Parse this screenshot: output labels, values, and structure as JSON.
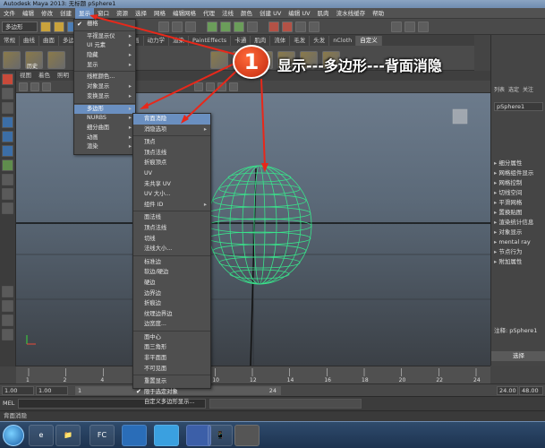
{
  "window": {
    "title": "Autodesk Maya 2013: 无标题   pSphere1"
  },
  "menubar": {
    "items": [
      "文件",
      "编辑",
      "修改",
      "创建",
      "显示",
      "窗口",
      "资源",
      "选择",
      "网格",
      "编辑网格",
      "代理",
      "法线",
      "颜色",
      "创建 UV",
      "编辑 UV",
      "肌肉",
      "流水线缓存",
      "帮助"
    ]
  },
  "toolbar": {
    "mode": "多边形"
  },
  "shelf": {
    "tabs": [
      "常规",
      "曲线",
      "曲面",
      "多边形",
      "细分",
      "变形",
      "动画",
      "动力学",
      "渲染",
      "PaintEffects",
      "卡通",
      "肌肉",
      "流体",
      "毛发",
      "头发",
      "nCloth",
      "自定义"
    ],
    "active_tab": "自定义",
    "icon_labels": [
      "历史"
    ]
  },
  "viewport": {
    "menu": [
      "视图",
      "着色",
      "照明",
      "显示",
      "面板"
    ],
    "label": "persp"
  },
  "display_menu": {
    "items": [
      {
        "label": "栅格",
        "check": true,
        "sub": false
      },
      {
        "label": "平视显示仪",
        "check": false,
        "sub": true
      },
      {
        "label": "UI 元素",
        "check": false,
        "sub": true
      },
      {
        "label": "隐藏",
        "check": false,
        "sub": true
      },
      {
        "label": "显示",
        "check": false,
        "sub": true
      },
      {
        "label": "线框颜色...",
        "check": false,
        "sub": false
      },
      {
        "label": "对象显示",
        "check": false,
        "sub": true
      },
      {
        "label": "变换显示",
        "check": false,
        "sub": true
      },
      {
        "label": "多边形",
        "check": false,
        "sub": true,
        "highlight": true
      },
      {
        "label": "NURBS",
        "check": false,
        "sub": true
      },
      {
        "label": "细分曲面",
        "check": false,
        "sub": true
      },
      {
        "label": "动画",
        "check": false,
        "sub": true
      },
      {
        "label": "渲染",
        "check": false,
        "sub": true
      }
    ]
  },
  "polygon_submenu": {
    "items": [
      {
        "label": "背面消隐",
        "highlight": true
      },
      {
        "label": "消隐选项",
        "sub": true
      },
      {
        "label": "顶点"
      },
      {
        "label": "顶点法线"
      },
      {
        "label": "折痕顶点"
      },
      {
        "label": "UV"
      },
      {
        "label": "未共享 UV"
      },
      {
        "label": "UV 大小..."
      },
      {
        "label": "组件 ID",
        "sub": true
      },
      {
        "label": "面法线"
      },
      {
        "label": "顶点法线"
      },
      {
        "label": "切线"
      },
      {
        "label": "法线大小..."
      },
      {
        "label": "标准边"
      },
      {
        "label": "软边/硬边"
      },
      {
        "label": "硬边"
      },
      {
        "label": "边界边"
      },
      {
        "label": "折痕边"
      },
      {
        "label": "纹理边界边"
      },
      {
        "label": "边宽度..."
      },
      {
        "label": "面中心"
      },
      {
        "label": "面三角形"
      },
      {
        "label": "非平面面"
      },
      {
        "label": "不可见面"
      },
      {
        "label": "重置显示"
      },
      {
        "label": "限于选定对象",
        "check": true
      },
      {
        "label": "自定义多边形显示..."
      }
    ]
  },
  "callout": {
    "number": "1",
    "text": "显示---多边形---背面消隐"
  },
  "right_panel": {
    "tabs": [
      "列表",
      "选定",
      "关注"
    ],
    "object_name": "pSphere1",
    "items": [
      "细分属性",
      "网格组件显示",
      "网格控制",
      "切线空间",
      "平滑网格",
      "置换贴图",
      "渲染统计信息",
      "对象显示",
      "mental ray",
      "节点行为",
      "附加属性"
    ],
    "note": "注释: pSphere1",
    "select_button": "选择"
  },
  "timeline": {
    "ticks": [
      "1",
      "2",
      "4",
      "6",
      "8",
      "10",
      "12",
      "14",
      "16",
      "18",
      "20",
      "22",
      "24"
    ]
  },
  "range": {
    "start": "1.00",
    "start2": "1.00",
    "mid": "1",
    "end_mark": "24",
    "end": "24.00",
    "end2": "48.00"
  },
  "mel": {
    "label": "MEL"
  },
  "helpline": {
    "text": "背面消隐"
  },
  "taskbar": {
    "apps": [
      "e",
      "📁",
      "FC",
      "",
      "",
      "",
      "📱",
      ""
    ]
  }
}
